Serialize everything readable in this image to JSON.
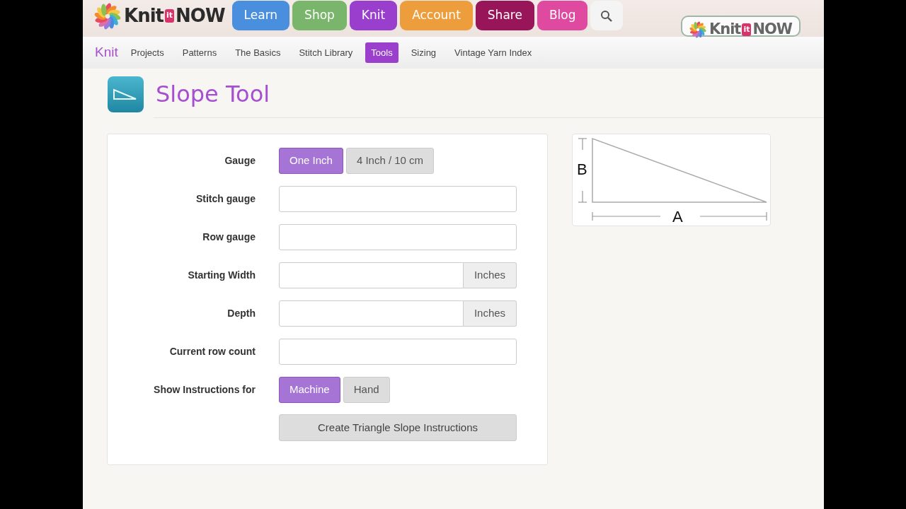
{
  "header": {
    "logo": [
      "Knit",
      "it",
      "NOW"
    ],
    "nav": [
      {
        "label": "Learn",
        "color": "#4a8fde"
      },
      {
        "label": "Shop",
        "color": "#79b56a"
      },
      {
        "label": "Knit",
        "color": "#9a3fcd"
      },
      {
        "label": "Account",
        "color": "#ee9d3c"
      },
      {
        "label": "Share",
        "color": "#99155a"
      },
      {
        "label": "Blog",
        "color": "#df4aa0"
      }
    ],
    "badge_logo": [
      "Knit",
      "it",
      "NOW"
    ]
  },
  "subnav": {
    "title": "Knit",
    "items": [
      {
        "label": "Projects",
        "selected": false
      },
      {
        "label": "Patterns",
        "selected": false
      },
      {
        "label": "The Basics",
        "selected": false
      },
      {
        "label": "Stitch Library",
        "selected": false
      },
      {
        "label": "Tools",
        "selected": true
      },
      {
        "label": "Sizing",
        "selected": false
      },
      {
        "label": "Vintage Yarn Index",
        "selected": false
      }
    ]
  },
  "page_title": "Slope Tool",
  "form": [
    {
      "kind": "toggle",
      "label": "Gauge",
      "options": [
        {
          "label": "One Inch",
          "selected": true
        },
        {
          "label": "4 Inch / 10 cm",
          "selected": false
        }
      ]
    },
    {
      "kind": "input",
      "label": "Stitch gauge"
    },
    {
      "kind": "input",
      "label": "Row gauge"
    },
    {
      "kind": "input",
      "label": "Starting Width",
      "addon": "Inches"
    },
    {
      "kind": "input",
      "label": "Depth",
      "addon": "Inches"
    },
    {
      "kind": "input",
      "label": "Current row count"
    },
    {
      "kind": "toggle",
      "label": "Show Instructions for",
      "options": [
        {
          "label": "Machine",
          "selected": true
        },
        {
          "label": "Hand",
          "selected": false
        }
      ]
    },
    {
      "kind": "submit",
      "label": "Create Triangle Slope Instructions"
    }
  ],
  "diagram": {
    "height_label": "B",
    "width_label": "A"
  }
}
